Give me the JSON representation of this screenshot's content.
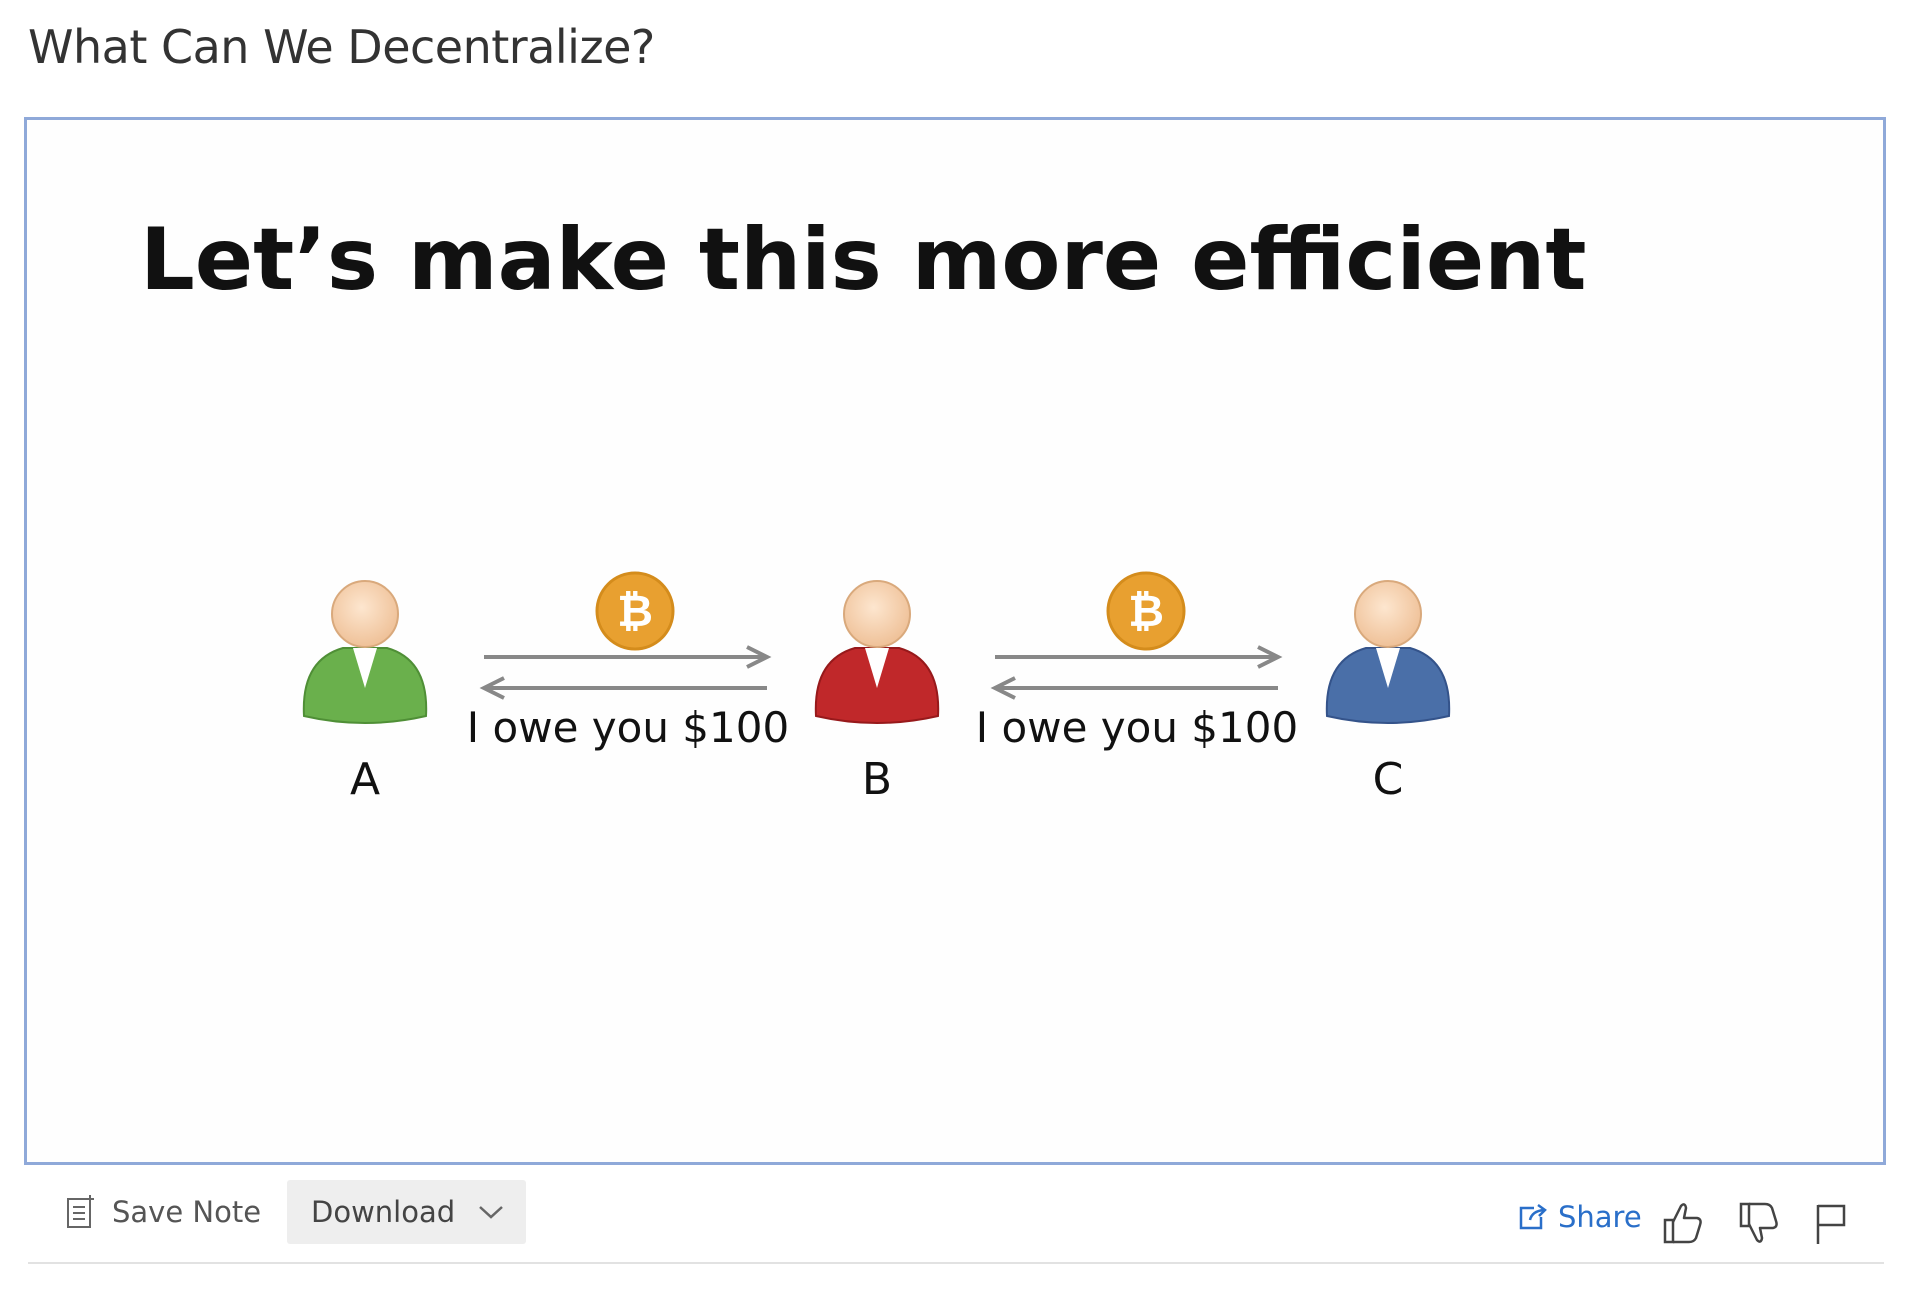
{
  "page": {
    "title": "What Can We Decentralize?"
  },
  "slide": {
    "heading": "Let’s make this more efficient",
    "people": [
      {
        "label": "A",
        "shirt_color": "#6ab04c"
      },
      {
        "label": "B",
        "shirt_color": "#c0282a"
      },
      {
        "label": "C",
        "shirt_color": "#4a6fa8"
      }
    ],
    "transfers": [
      {
        "text": "I owe you $100",
        "coin": "bitcoin-icon"
      },
      {
        "text": "I owe you $100",
        "coin": "bitcoin-icon"
      }
    ]
  },
  "toolbar": {
    "save_note_label": "Save Note",
    "download_label": "Download",
    "share_label": "Share"
  },
  "colors": {
    "frame_border": "#8fa9d9",
    "link_blue": "#2a6fc9",
    "coin": "#e8a030",
    "skin": "#f7cfa8"
  }
}
